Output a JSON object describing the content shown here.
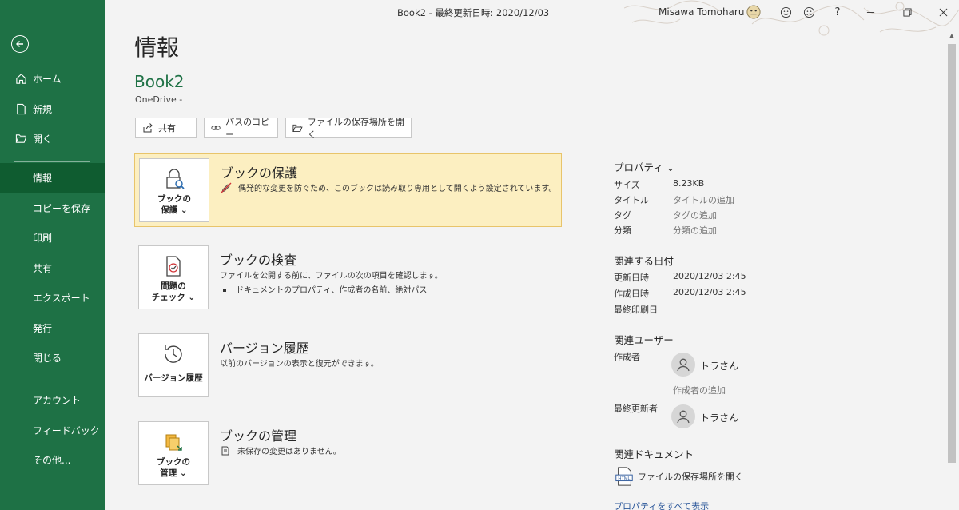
{
  "titlebar": {
    "doc_title": "Book2 - 最終更新日時: 2020/12/03",
    "user_name": "Misawa Tomoharu",
    "help": "?"
  },
  "sidebar": {
    "top_items": [
      {
        "label": "ホーム",
        "icon": "home-icon"
      },
      {
        "label": "新規",
        "icon": "new-file-icon"
      },
      {
        "label": "開く",
        "icon": "open-folder-icon"
      }
    ],
    "sub_items": [
      "情報",
      "コピーを保存",
      "印刷",
      "共有",
      "エクスポート",
      "発行",
      "閉じる"
    ],
    "bottom_items": [
      "アカウント",
      "フィードバック",
      "その他..."
    ]
  },
  "main": {
    "page_title": "情報",
    "book_name": "Book2",
    "location": "OneDrive -",
    "actions": [
      "共有",
      "パスのコピー",
      "ファイルの保存場所を開く"
    ],
    "sections": [
      {
        "btn": [
          "ブックの",
          "保護 ⌄"
        ],
        "title": "ブックの保護",
        "desc": "偶発的な変更を防ぐため、このブックは読み取り専用として開くよう設定されています。"
      },
      {
        "btn": [
          "問題の",
          "チェック ⌄"
        ],
        "title": "ブックの検査",
        "desc": "ファイルを公開する前に、ファイルの次の項目を確認します。",
        "bullet": "ドキュメントのプロパティ、作成者の名前、絶対パス"
      },
      {
        "btn": [
          "バージョン履歴"
        ],
        "title": "バージョン履歴",
        "desc": "以前のバージョンの表示と復元ができます。"
      },
      {
        "btn": [
          "ブックの",
          "管理 ⌄"
        ],
        "title": "ブックの管理",
        "desc": "未保存の変更はありません。"
      }
    ]
  },
  "properties": {
    "heading": "プロパティ ⌄",
    "rows": [
      {
        "key": "サイズ",
        "value": "8.23KB"
      },
      {
        "key": "タイトル",
        "value": "タイトルの追加"
      },
      {
        "key": "タグ",
        "value": "タグの追加"
      },
      {
        "key": "分類",
        "value": "分類の追加"
      }
    ],
    "dates_heading": "関連する日付",
    "dates": [
      {
        "key": "更新日時",
        "value": "2020/12/03 2:45"
      },
      {
        "key": "作成日時",
        "value": "2020/12/03 2:45"
      },
      {
        "key": "最終印刷日",
        "value": ""
      }
    ],
    "users_heading": "関連ユーザー",
    "author_label": "作成者",
    "author_name": "トラさん",
    "add_author": "作成者の追加",
    "last_modified_label": "最終更新者",
    "last_modified_name": "トラさん",
    "docs_heading": "関連ドキュメント",
    "open_location": "ファイルの保存場所を開く",
    "show_all": "プロパティをすべて表示"
  },
  "colors": {
    "accent": "#1e7145",
    "highlight": "#fcefc1",
    "link": "#2b579a"
  }
}
